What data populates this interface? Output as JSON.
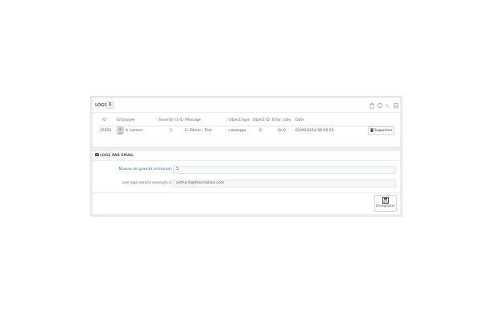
{
  "logs_panel": {
    "title": "LOGS",
    "count": "1",
    "toolbar_icons": [
      "trash-icon",
      "refresh-icon",
      "terminal-icon",
      "database-icon"
    ],
    "columns": [
      "ID",
      "Employee",
      "Severity (1-4)",
      "Message",
      "Object type",
      "Object ID",
      "Error code",
      "Date"
    ],
    "rows": [
      {
        "id": "25352",
        "employee": "A. Lemon",
        "severity": "1",
        "message": "Ei Désno - Test",
        "object_type": "catalogue",
        "object_id": "0",
        "error_code": "0x 0",
        "date": "03/09/2018 09:29:55",
        "action_label": "Supprimer"
      }
    ]
  },
  "email_panel": {
    "title": "LOGS PAR EMAIL",
    "severity_label": "Niveau de gravité minimum",
    "severity_value": "5",
    "recipient_label": "Les logs seront envoyés à",
    "recipient_value": "arthur.lt@thecreation.com",
    "save_label": "Enregistrer"
  }
}
